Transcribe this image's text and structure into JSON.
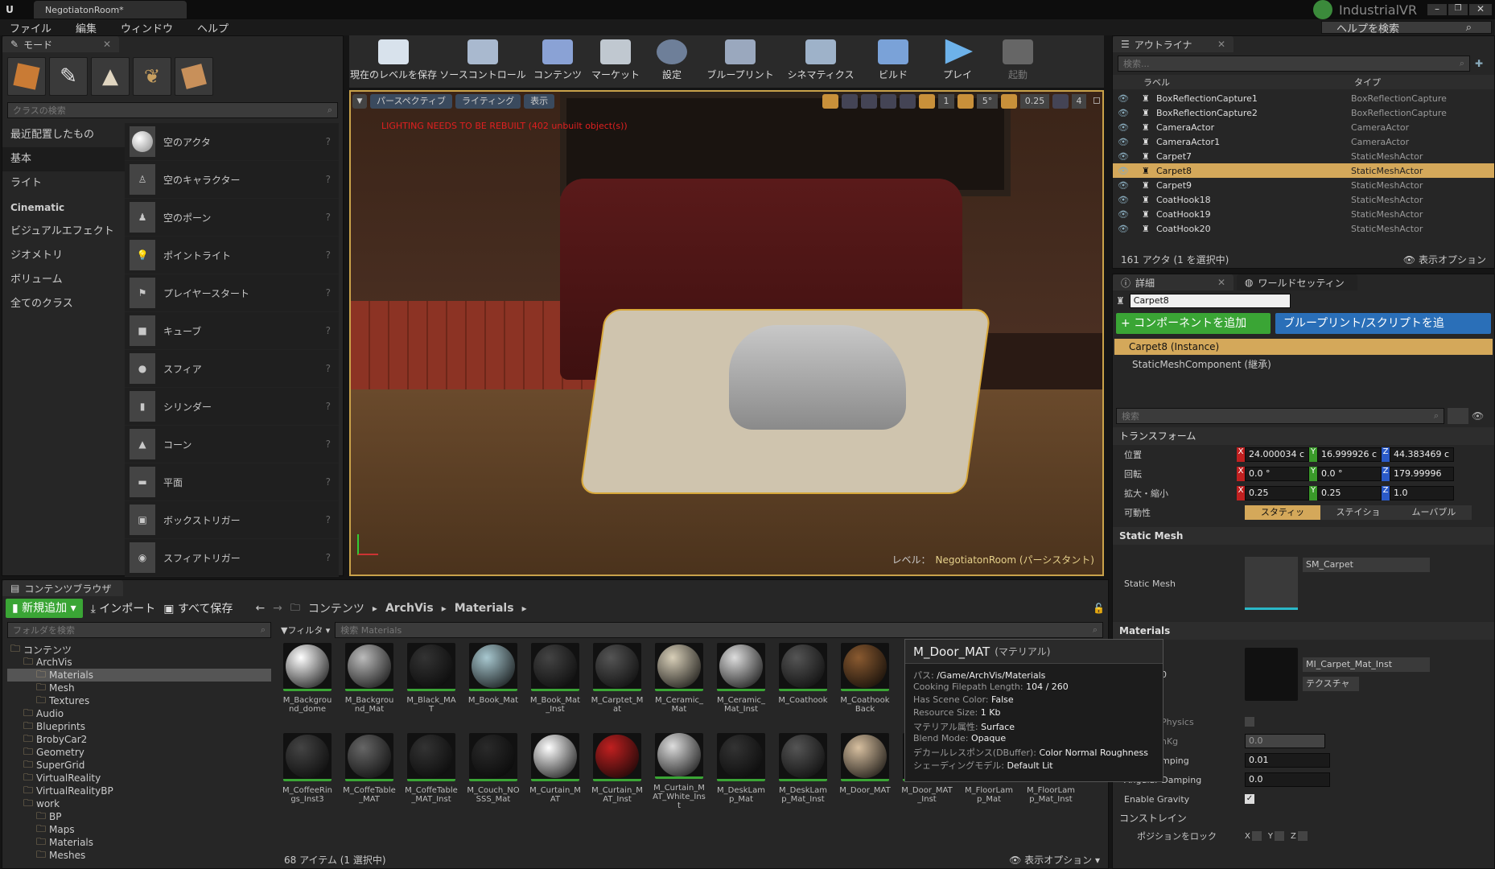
{
  "app": {
    "tab_title": "NegotiatonRoom*",
    "project": "IndustrialVR",
    "help_search": "ヘルプを検索"
  },
  "menu": [
    "ファイル",
    "編集",
    "ウィンドウ",
    "ヘルプ"
  ],
  "modes": {
    "tab": "モード",
    "search_placeholder": "クラスの検索",
    "categories": [
      "最近配置したもの",
      "基本",
      "ライト",
      "Cinematic",
      "ビジュアルエフェクト",
      "ジオメトリ",
      "ボリューム",
      "全てのクラス"
    ],
    "items": [
      "空のアクタ",
      "空のキャラクター",
      "空のポーン",
      "ポイントライト",
      "プレイヤースタート",
      "キューブ",
      "スフィア",
      "シリンダー",
      "コーン",
      "平面",
      "ボックストリガー",
      "スフィアトリガー"
    ]
  },
  "toolbar": [
    "現在のレベルを保存",
    "ソースコントロール",
    "コンテンツ",
    "マーケット",
    "設定",
    "ブループリント",
    "シネマティクス",
    "ビルド",
    "プレイ",
    "起動"
  ],
  "viewport": {
    "perspective": "パースペクティブ",
    "lighting": "ライティング",
    "show": "表示",
    "warning": "LIGHTING NEEDS TO BE REBUILT (402 unbuilt object(s))",
    "angle": "5°",
    "scale": "0.25",
    "speed": "4",
    "grid": "1",
    "level_label": "レベル：",
    "level_name": "NegotiatonRoom (パーシスタント)"
  },
  "outliner": {
    "tab": "アウトライナ",
    "search_placeholder": "検索...",
    "col_label": "ラベル",
    "col_type": "タイプ",
    "rows": [
      {
        "label": "BoxReflectionCapture1",
        "type": "BoxReflectionCapture"
      },
      {
        "label": "BoxReflectionCapture2",
        "type": "BoxReflectionCapture"
      },
      {
        "label": "CameraActor",
        "type": "CameraActor"
      },
      {
        "label": "CameraActor1",
        "type": "CameraActor"
      },
      {
        "label": "Carpet7",
        "type": "StaticMeshActor"
      },
      {
        "label": "Carpet8",
        "type": "StaticMeshActor"
      },
      {
        "label": "Carpet9",
        "type": "StaticMeshActor"
      },
      {
        "label": "CoatHook18",
        "type": "StaticMeshActor"
      },
      {
        "label": "CoatHook19",
        "type": "StaticMeshActor"
      },
      {
        "label": "CoatHook20",
        "type": "StaticMeshActor"
      }
    ],
    "count": "161 アクタ (1 を選択中)",
    "view_options": "表示オプション"
  },
  "details": {
    "tab": "詳細",
    "tab2": "ワールドセッティン",
    "name": "Carpet8",
    "add_component": "+ コンポーネントを追加",
    "blueprint": "ブループリント/スクリプトを追",
    "instance": "Carpet8 (Instance)",
    "component": "StaticMeshComponent (継承)",
    "search_placeholder": "検索",
    "transform": "トランスフォーム",
    "location_label": "位置",
    "rotation_label": "回転",
    "scale_label": "拡大・縮小",
    "mobility_label": "可動性",
    "location": [
      "24.000034 c",
      "16.999926 c",
      "44.383469 c"
    ],
    "rotation": [
      "0.0 °",
      "0.0 °",
      "179.99996"
    ],
    "scale": [
      "0.25",
      "0.25",
      "1.0"
    ],
    "mobility": [
      "スタティッ",
      "ステイショ",
      "ムーバブル"
    ],
    "static_mesh_section": "Static Mesh",
    "static_mesh_label": "Static Mesh",
    "static_mesh_value": "SM_Carpet",
    "materials_section": "Materials",
    "element0": "0",
    "material_value": "MI_Carpet_Mat_Inst",
    "texture_btn": "テクスチャ",
    "physics_label": "Physics",
    "mass_label": "nKg",
    "mass_value": "0.0",
    "linear_label": "mping",
    "linear_value": "0.01",
    "angular_label": "Angular Damping",
    "angular_value": "0.0",
    "gravity_label": "Enable Gravity",
    "constraints": "コンストレイン",
    "lock_label": "ポジションをロック",
    "lock_axes": [
      "X",
      "Y",
      "Z"
    ]
  },
  "content": {
    "tab": "コンテンツブラウザ",
    "add_new": "新規追加",
    "import": "インポート",
    "save_all": "すべて保存",
    "path": [
      "コンテンツ",
      "ArchVis",
      "Materials"
    ],
    "folder_search": "フォルダを検索",
    "filter": "フィルタ",
    "asset_search": "検索 Materials",
    "tree": [
      {
        "name": "コンテンツ",
        "level": 0
      },
      {
        "name": "ArchVis",
        "level": 1
      },
      {
        "name": "Materials",
        "level": 2,
        "sel": true
      },
      {
        "name": "Mesh",
        "level": 2
      },
      {
        "name": "Textures",
        "level": 2
      },
      {
        "name": "Audio",
        "level": 1
      },
      {
        "name": "Blueprints",
        "level": 1
      },
      {
        "name": "BrobyCar2",
        "level": 1
      },
      {
        "name": "Geometry",
        "level": 1
      },
      {
        "name": "SuperGrid",
        "level": 1
      },
      {
        "name": "VirtualReality",
        "level": 1
      },
      {
        "name": "VirtualRealityBP",
        "level": 1
      },
      {
        "name": "work",
        "level": 1
      },
      {
        "name": "BP",
        "level": 2
      },
      {
        "name": "Maps",
        "level": 2
      },
      {
        "name": "Materials",
        "level": 2
      },
      {
        "name": "Meshes",
        "level": 2
      }
    ],
    "assets_row1": [
      "M_Background_dome",
      "M_Background_Mat",
      "M_Black_MAT",
      "M_Book_Mat",
      "M_Book_Mat_Inst",
      "M_Carptet_Mat",
      "M_Ceramic_Mat",
      "M_Ceramic_Mat_Inst",
      "M_Coathook",
      "M_Coathook Back"
    ],
    "assets_row2": [
      "M_CoffeeRings_Inst3",
      "M_CoffeTable_MAT",
      "M_CoffeTable_MAT_Inst",
      "M_Couch_NOSSS_Mat",
      "M_Curtain_MAT",
      "M_Curtain_MAT_Inst",
      "M_Curtain_MAT_White_Inst",
      "M_DeskLamp_Mat",
      "M_DeskLamp_Mat_Inst",
      "M_Door_MAT",
      "M_Door_MAT_Inst",
      "M_FloorLamp_Mat",
      "M_FloorLamp_Mat_Inst"
    ],
    "count": "68 アイテム (1 選択中)",
    "view_options": "表示オプション"
  },
  "tooltip": {
    "title": "M_Door_MAT",
    "subtitle": "(マテリアル)",
    "lines": [
      {
        "k": "パス:",
        "v": "/Game/ArchVis/Materials"
      },
      {
        "k": "Cooking Filepath Length:",
        "v": "104 / 260"
      },
      {
        "k": "Has Scene Color:",
        "v": "False"
      },
      {
        "k": "Resource Size:",
        "v": "1 Kb"
      },
      {
        "k": "マテリアル属性:",
        "v": "Surface"
      },
      {
        "k": "Blend Mode:",
        "v": "Opaque"
      },
      {
        "k": "デカールレスポンス(DBuffer):",
        "v": "Color Normal Roughness"
      },
      {
        "k": "シェーディングモデル:",
        "v": "Default Lit"
      }
    ]
  }
}
